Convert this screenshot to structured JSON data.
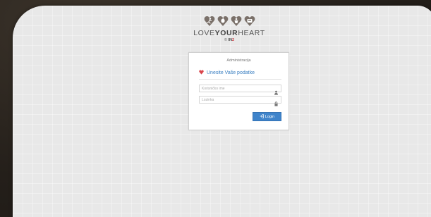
{
  "brand": {
    "wordmark_light_1": "LOVE",
    "wordmark_bold": "YOUR",
    "wordmark_light_2": "HEART",
    "copyright": "©",
    "company_1": "IN",
    "company_2": "2",
    "heart_color": "#7a7069"
  },
  "login": {
    "section_title": "Administracija",
    "heading": "Unesite Vaše podatke",
    "username_placeholder": "Korisničko ime",
    "password_placeholder": "Lozinka",
    "button_label": "Login",
    "accent_color": "#3f84cb",
    "heart_icon_color": "#d9454b"
  },
  "icons": {
    "heading": "heart-icon",
    "username": "user-icon",
    "password": "lock-icon",
    "button": "sign-in-icon"
  }
}
